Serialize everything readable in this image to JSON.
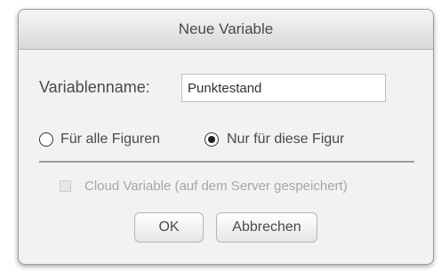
{
  "dialog": {
    "title": "Neue Variable",
    "name_label": "Variablenname:",
    "name_value": "Punktestand",
    "scope_options": [
      {
        "label": "Für alle Figuren",
        "selected": false
      },
      {
        "label": "Nur für diese Figur",
        "selected": true
      }
    ],
    "cloud_label": "Cloud Variable (auf dem Server gespeichert)",
    "cloud_checked": false,
    "cloud_enabled": false,
    "ok_label": "OK",
    "cancel_label": "Abbrechen"
  }
}
